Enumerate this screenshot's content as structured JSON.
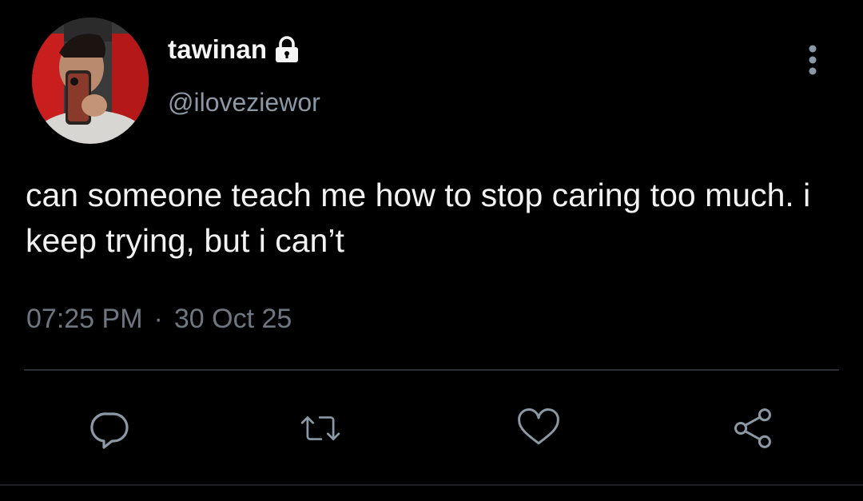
{
  "tweet": {
    "display_name": "tawinan",
    "handle": "@iloveziewor",
    "text": "can someone teach me how to stop caring too much. i keep trying, but i can’t",
    "time": "07:25 PM",
    "separator": "·",
    "date": "30 Oct 25",
    "protected": true
  },
  "icons": {
    "lock": "lock-icon",
    "more": "more-vertical-icon",
    "reply": "reply-icon",
    "retweet": "retweet-icon",
    "like": "heart-icon",
    "share": "share-icon"
  },
  "colors": {
    "background": "#000000",
    "text": "#f2f2f2",
    "secondary": "#8b98a5",
    "meta": "#6e7781"
  }
}
